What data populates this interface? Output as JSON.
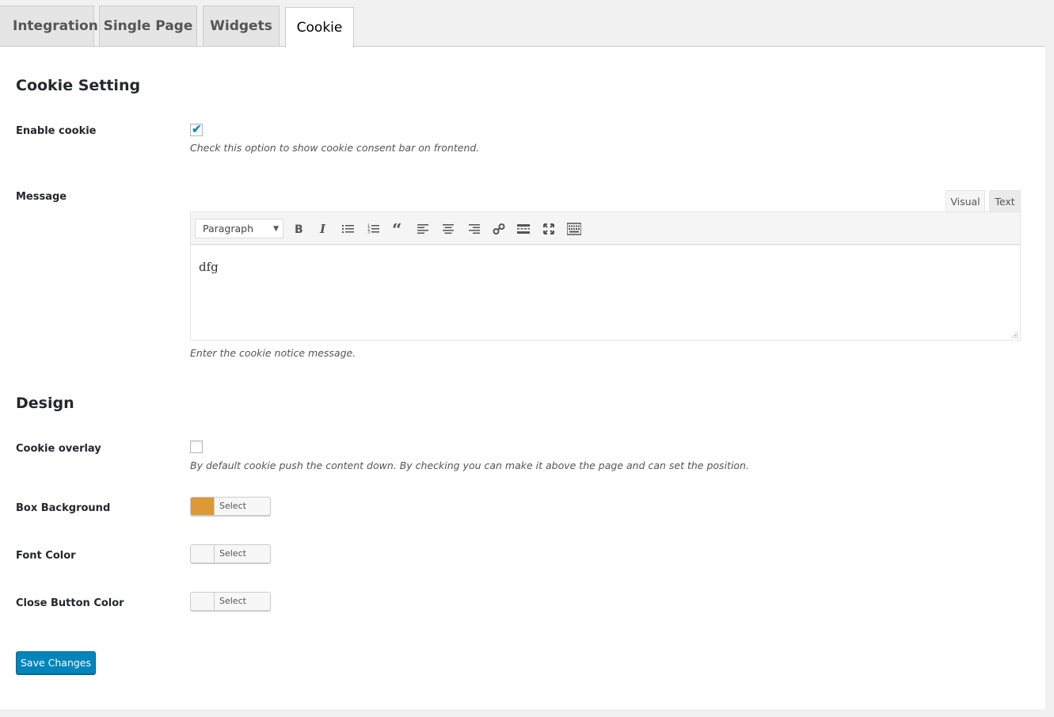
{
  "tabs": [
    {
      "label": "Integration",
      "active": false
    },
    {
      "label": "Single Page",
      "active": false
    },
    {
      "label": "Widgets",
      "active": false
    },
    {
      "label": "Cookie",
      "active": true
    }
  ],
  "cookie_setting": {
    "title": "Cookie Setting",
    "enable_cookie": {
      "label": "Enable cookie",
      "checked": true,
      "description": "Check this option to show cookie consent bar on frontend."
    },
    "message": {
      "label": "Message",
      "editor_tabs": {
        "visual": "Visual",
        "text": "Text",
        "active": "Visual"
      },
      "format_select": "Paragraph",
      "toolbar_icons": [
        "bold-icon",
        "italic-icon",
        "bullet-list-icon",
        "numbered-list-icon",
        "blockquote-icon",
        "align-left-icon",
        "align-center-icon",
        "align-right-icon",
        "link-icon",
        "read-more-icon",
        "fullscreen-icon",
        "toolbar-toggle-icon"
      ],
      "content": "dfg",
      "description": "Enter the cookie notice message."
    }
  },
  "design": {
    "title": "Design",
    "cookie_overlay": {
      "label": "Cookie overlay",
      "checked": false,
      "description": "By default cookie push the content down. By checking you can make it above the page and can set the position."
    },
    "box_background": {
      "label": "Box Background",
      "button_label": "Select Color",
      "color": "#dd9933"
    },
    "font_color": {
      "label": "Font Color",
      "button_label": "Select Color",
      "color": "#f7f7f7"
    },
    "close_button_color": {
      "label": "Close Button Color",
      "button_label": "Select Color",
      "color": "#f7f7f7"
    }
  },
  "save_button": "Save Changes",
  "colors": {
    "primary": "#0085ba",
    "checkmark": "#1e8cbe"
  }
}
